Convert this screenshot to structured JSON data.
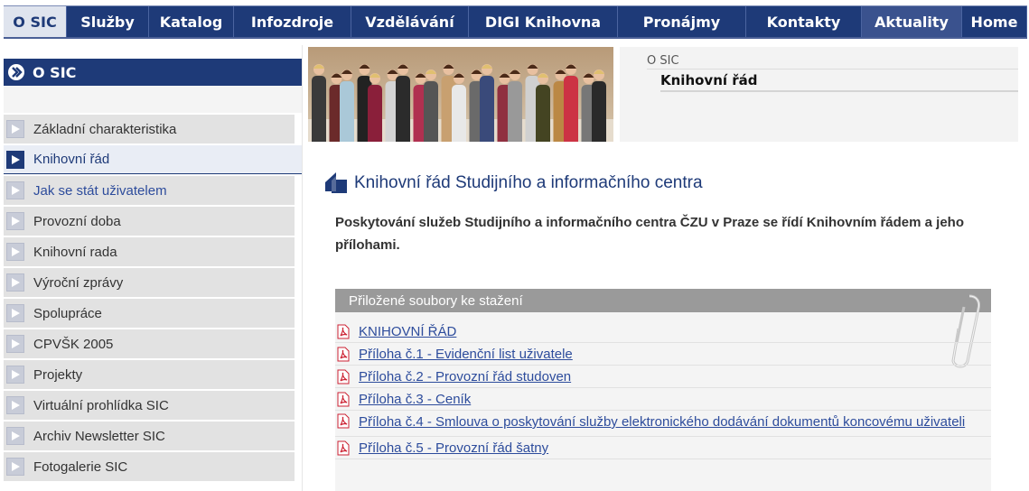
{
  "topnav": {
    "items": [
      {
        "label": "O SIC",
        "width": 70,
        "state": "active"
      },
      {
        "label": "Služby",
        "width": 91
      },
      {
        "label": "Katalog",
        "width": 94
      },
      {
        "label": "Infozdroje",
        "width": 130
      },
      {
        "label": "Vzdělávání",
        "width": 130
      },
      {
        "label": "DIGI Knihovna",
        "width": 165
      },
      {
        "label": "Pronájmy",
        "width": 142
      },
      {
        "label": "Kontakty",
        "width": 128
      },
      {
        "label": "Aktuality",
        "width": 111,
        "state": "highlight"
      },
      {
        "label": "Home",
        "width": 72
      }
    ]
  },
  "sidebar": {
    "heading": "O SIC",
    "items": [
      {
        "label": "Základní charakteristika"
      },
      {
        "label": "Knihovní řád",
        "active": true
      },
      {
        "label": "Jak se stát uživatelem",
        "link": true
      },
      {
        "label": "Provozní doba"
      },
      {
        "label": "Knihovní rada"
      },
      {
        "label": "Výroční zprávy"
      },
      {
        "label": "Spolupráce"
      },
      {
        "label": "CPVŠK 2005"
      },
      {
        "label": "Projekty"
      },
      {
        "label": "Virtuální prohlídka SIC"
      },
      {
        "label": "Archiv Newsletter SIC"
      },
      {
        "label": "Fotogalerie SIC"
      }
    ]
  },
  "breadcrumb": {
    "parent": "O SIC",
    "current": "Knihovní řád"
  },
  "content": {
    "title": "Knihovní řád Studijního a informačního centra",
    "intro": "Poskytování služeb Studijního a informačního centra ČZU v Praze se řídí Knihovním řádem a jeho přílohami."
  },
  "attachments": {
    "heading": "Přiložené soubory ke stažení",
    "files": [
      {
        "label": "KNIHOVNÍ ŘÁD",
        "icon": "pdf-icon"
      },
      {
        "label": "Příloha č.1 - Evidenční list uživatele",
        "icon": "pdf-icon"
      },
      {
        "label": "Příloha č.2 - Provozní řád studoven",
        "icon": "pdf-icon"
      },
      {
        "label": "Příloha č.3 - Ceník",
        "icon": "pdf-icon"
      },
      {
        "label": "Příloha č.4 - Smlouva o poskytování služby elektronického dodávání dokumentů koncovému uživateli",
        "icon": "pdf-icon",
        "wrap": true
      },
      {
        "label": "Příloha č.5 - Provozní řád šatny",
        "icon": "pdf-icon"
      }
    ]
  },
  "colors": {
    "nav_blue": "#1e3a78",
    "link_blue": "#2d4c9c",
    "attachment_header": "#9a9a9a"
  }
}
